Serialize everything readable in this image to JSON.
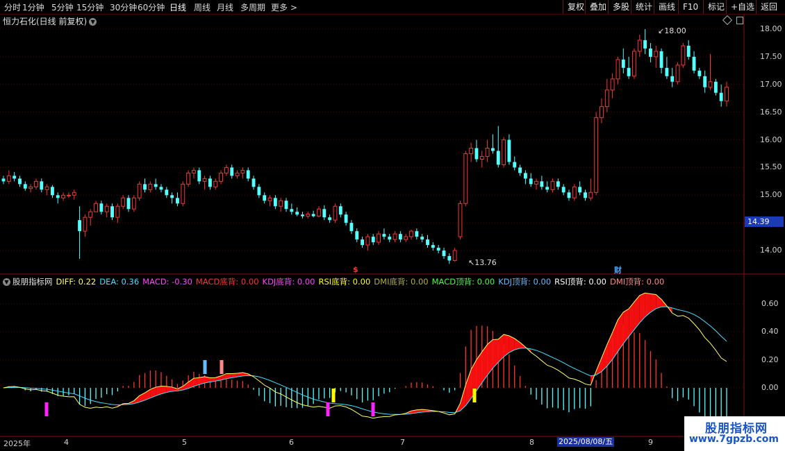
{
  "toolbar": {
    "left": [
      "分时",
      "1分钟",
      "5分钟",
      "15分钟",
      "30分钟",
      "60分钟",
      "日线",
      "周线",
      "月线",
      "多周期",
      "更多 >"
    ],
    "active": "日线",
    "right": [
      "复权",
      "叠加",
      "多股",
      "统计",
      "画线",
      "F10",
      "标记",
      "+自选",
      "返回"
    ]
  },
  "main_title": "恒力石化(日线 前复权)",
  "current_price": "14.39",
  "price_axis": [
    "18.00",
    "17.50",
    "17.00",
    "16.50",
    "16.00",
    "15.50",
    "15.00",
    "14.00"
  ],
  "annotations": {
    "high": "18.00",
    "low": "13.76",
    "marker_s": "$",
    "marker_cai": "财"
  },
  "indicator": {
    "name": "股朋指标网",
    "items": [
      {
        "label": "DIFF: 0.22",
        "color": "#ffff66"
      },
      {
        "label": "DEA: 0.36",
        "color": "#44e0ff"
      },
      {
        "label": "MACD: -0.30",
        "color": "#ff44ff"
      },
      {
        "label": "MACD底背: 0.00",
        "color": "#ff3333"
      },
      {
        "label": "KDJ底背: 0.00",
        "color": "#ff44ff"
      },
      {
        "label": "RSI底背: 0.00",
        "color": "#ffff00"
      },
      {
        "label": "DMI底背: 0.00",
        "color": "#b0b040"
      },
      {
        "label": "MACD顶背: 0.00",
        "color": "#44ff44"
      },
      {
        "label": "KDJ顶背: 0.00",
        "color": "#66bbff"
      },
      {
        "label": "RSI顶背: 0.00",
        "color": "#ffffff"
      },
      {
        "label": "DMI顶背: 0.00",
        "color": "#ff8888"
      }
    ],
    "axis": [
      "0.60",
      "0.40",
      "0.20",
      "0.00"
    ]
  },
  "time_axis": [
    "2025年",
    "4",
    "5",
    "6",
    "7",
    "8",
    "9"
  ],
  "selected_date": "2025/08/08/五",
  "watermark": {
    "title": "股朋指标网",
    "url": "www.7gpzb.com"
  },
  "colors": {
    "up": "#ff3333",
    "down": "#54ffff",
    "grid": "#5a0000"
  },
  "chart_data": {
    "type": "candlestick",
    "title": "恒力石化(日线 前复权)",
    "ylim": [
      13.6,
      18.15
    ],
    "candles": [
      [
        15.3,
        15.35,
        15.2,
        15.25
      ],
      [
        15.25,
        15.45,
        15.2,
        15.35
      ],
      [
        15.35,
        15.42,
        15.25,
        15.3
      ],
      [
        15.3,
        15.35,
        15.15,
        15.2
      ],
      [
        15.2,
        15.25,
        15.08,
        15.12
      ],
      [
        15.12,
        15.2,
        15.05,
        15.15
      ],
      [
        15.15,
        15.3,
        15.1,
        15.25
      ],
      [
        15.25,
        15.3,
        15.05,
        15.1
      ],
      [
        15.1,
        15.2,
        15.0,
        15.15
      ],
      [
        15.15,
        15.18,
        14.95,
        15.0
      ],
      [
        15.0,
        15.05,
        14.85,
        14.95
      ],
      [
        14.95,
        15.05,
        14.9,
        15.0
      ],
      [
        15.0,
        15.05,
        14.95,
        15.0
      ],
      [
        15.0,
        15.1,
        14.92,
        15.05
      ],
      [
        14.55,
        14.8,
        13.85,
        14.35
      ],
      [
        14.35,
        14.65,
        14.25,
        14.6
      ],
      [
        14.6,
        14.75,
        14.45,
        14.7
      ],
      [
        14.7,
        14.9,
        14.7,
        14.85
      ],
      [
        14.85,
        14.9,
        14.65,
        14.7
      ],
      [
        14.7,
        14.85,
        14.6,
        14.8
      ],
      [
        14.8,
        14.85,
        14.55,
        14.6
      ],
      [
        14.6,
        14.85,
        14.5,
        14.8
      ],
      [
        14.8,
        15.0,
        14.75,
        14.95
      ],
      [
        14.95,
        15.0,
        14.7,
        14.75
      ],
      [
        14.75,
        15.0,
        14.7,
        14.95
      ],
      [
        14.95,
        15.25,
        14.9,
        15.2
      ],
      [
        15.2,
        15.3,
        15.05,
        15.1
      ],
      [
        15.1,
        15.25,
        15.05,
        15.2
      ],
      [
        15.2,
        15.3,
        15.1,
        15.15
      ],
      [
        15.15,
        15.2,
        15.05,
        15.1
      ],
      [
        15.1,
        15.15,
        14.95,
        15.0
      ],
      [
        15.0,
        15.05,
        14.85,
        14.95
      ],
      [
        14.95,
        15.05,
        14.8,
        14.85
      ],
      [
        14.85,
        15.25,
        14.8,
        15.2
      ],
      [
        15.2,
        15.45,
        15.15,
        15.4
      ],
      [
        15.4,
        15.5,
        15.3,
        15.45
      ],
      [
        15.45,
        15.5,
        15.2,
        15.25
      ],
      [
        15.25,
        15.35,
        15.1,
        15.3
      ],
      [
        15.3,
        15.35,
        15.1,
        15.15
      ],
      [
        15.15,
        15.3,
        15.1,
        15.25
      ],
      [
        15.25,
        15.45,
        15.2,
        15.4
      ],
      [
        15.4,
        15.55,
        15.35,
        15.5
      ],
      [
        15.5,
        15.55,
        15.3,
        15.35
      ],
      [
        15.35,
        15.45,
        15.3,
        15.4
      ],
      [
        15.4,
        15.5,
        15.3,
        15.45
      ],
      [
        15.45,
        15.5,
        15.25,
        15.3
      ],
      [
        15.3,
        15.35,
        15.1,
        15.15
      ],
      [
        15.15,
        15.2,
        14.95,
        15.0
      ],
      [
        15.0,
        15.05,
        14.85,
        14.9
      ],
      [
        14.9,
        15.0,
        14.8,
        14.95
      ],
      [
        14.95,
        15.0,
        14.75,
        14.8
      ],
      [
        14.8,
        14.95,
        14.7,
        14.9
      ],
      [
        14.9,
        14.95,
        14.7,
        14.75
      ],
      [
        14.75,
        14.85,
        14.65,
        14.7
      ],
      [
        14.7,
        14.78,
        14.62,
        14.65
      ],
      [
        14.65,
        14.7,
        14.58,
        14.62
      ],
      [
        14.62,
        14.7,
        14.58,
        14.66
      ],
      [
        14.66,
        14.72,
        14.6,
        14.62
      ],
      [
        14.62,
        14.8,
        14.6,
        14.75
      ],
      [
        14.75,
        14.82,
        14.55,
        14.6
      ],
      [
        14.6,
        14.65,
        14.5,
        14.55
      ],
      [
        14.55,
        14.85,
        14.5,
        14.8
      ],
      [
        14.8,
        14.85,
        14.6,
        14.65
      ],
      [
        14.65,
        14.7,
        14.45,
        14.5
      ],
      [
        14.5,
        14.55,
        14.3,
        14.35
      ],
      [
        14.35,
        14.4,
        14.15,
        14.2
      ],
      [
        14.2,
        14.25,
        14.05,
        14.1
      ],
      [
        14.1,
        14.3,
        14.0,
        14.25
      ],
      [
        14.25,
        14.3,
        14.1,
        14.15
      ],
      [
        14.15,
        14.35,
        14.1,
        14.3
      ],
      [
        14.3,
        14.4,
        14.2,
        14.25
      ],
      [
        14.25,
        14.3,
        14.15,
        14.2
      ],
      [
        14.2,
        14.35,
        14.15,
        14.3
      ],
      [
        14.3,
        14.35,
        14.15,
        14.2
      ],
      [
        14.2,
        14.3,
        14.15,
        14.25
      ],
      [
        14.25,
        14.38,
        14.2,
        14.35
      ],
      [
        14.35,
        14.4,
        14.2,
        14.25
      ],
      [
        14.25,
        14.3,
        14.15,
        14.2
      ],
      [
        14.2,
        14.28,
        14.05,
        14.1
      ],
      [
        14.1,
        14.15,
        14.0,
        14.05
      ],
      [
        14.05,
        14.1,
        13.95,
        14.0
      ],
      [
        14.0,
        14.05,
        13.85,
        13.9
      ],
      [
        13.9,
        13.95,
        13.76,
        13.82
      ],
      [
        13.82,
        14.05,
        13.8,
        14.0
      ],
      [
        14.25,
        14.9,
        14.2,
        14.85
      ],
      [
        14.85,
        15.8,
        14.8,
        15.75
      ],
      [
        15.75,
        15.95,
        15.6,
        15.85
      ],
      [
        15.85,
        16.0,
        15.6,
        15.65
      ],
      [
        15.65,
        15.8,
        15.5,
        15.7
      ],
      [
        15.7,
        16.0,
        15.6,
        15.85
      ],
      [
        15.85,
        16.1,
        15.75,
        15.8
      ],
      [
        15.8,
        16.25,
        15.5,
        15.55
      ],
      [
        15.55,
        16.05,
        15.5,
        16.0
      ],
      [
        16.0,
        16.1,
        15.55,
        15.6
      ],
      [
        15.6,
        15.7,
        15.45,
        15.5
      ],
      [
        15.5,
        15.55,
        15.35,
        15.4
      ],
      [
        15.4,
        15.45,
        15.2,
        15.3
      ],
      [
        15.3,
        15.4,
        15.15,
        15.2
      ],
      [
        15.2,
        15.3,
        15.1,
        15.25
      ],
      [
        15.25,
        15.35,
        15.1,
        15.15
      ],
      [
        15.15,
        15.25,
        15.05,
        15.1
      ],
      [
        15.1,
        15.3,
        15.05,
        15.25
      ],
      [
        15.25,
        15.3,
        15.1,
        15.15
      ],
      [
        15.15,
        15.2,
        15.0,
        15.05
      ],
      [
        15.05,
        15.1,
        14.9,
        14.95
      ],
      [
        14.95,
        15.2,
        14.9,
        15.15
      ],
      [
        15.15,
        15.25,
        15.0,
        15.05
      ],
      [
        15.05,
        15.1,
        14.9,
        14.95
      ],
      [
        14.95,
        15.3,
        14.9,
        15.05
      ],
      [
        15.05,
        16.5,
        15.0,
        16.4
      ],
      [
        16.4,
        16.75,
        16.3,
        16.6
      ],
      [
        16.6,
        17.1,
        16.5,
        16.9
      ],
      [
        16.9,
        17.2,
        16.75,
        17.1
      ],
      [
        17.1,
        17.5,
        17.0,
        17.45
      ],
      [
        17.45,
        17.65,
        17.2,
        17.3
      ],
      [
        17.3,
        17.5,
        17.1,
        17.15
      ],
      [
        17.15,
        17.65,
        17.1,
        17.6
      ],
      [
        17.6,
        17.9,
        17.5,
        17.8
      ],
      [
        17.8,
        18.0,
        17.55,
        17.65
      ],
      [
        17.65,
        17.75,
        17.4,
        17.5
      ],
      [
        17.5,
        17.7,
        17.3,
        17.6
      ],
      [
        17.6,
        17.65,
        17.2,
        17.3
      ],
      [
        17.3,
        17.5,
        17.1,
        17.15
      ],
      [
        17.15,
        17.3,
        16.95,
        17.05
      ],
      [
        17.05,
        17.4,
        17.0,
        17.35
      ],
      [
        17.35,
        17.75,
        17.3,
        17.7
      ],
      [
        17.7,
        17.8,
        17.45,
        17.5
      ],
      [
        17.5,
        17.6,
        17.2,
        17.25
      ],
      [
        17.25,
        17.3,
        17.1,
        17.15
      ],
      [
        17.15,
        17.25,
        16.85,
        16.95
      ],
      [
        16.95,
        17.55,
        16.9,
        17.05
      ],
      [
        17.05,
        17.1,
        16.8,
        16.85
      ],
      [
        16.85,
        17.0,
        16.6,
        16.7
      ],
      [
        16.7,
        17.05,
        16.6,
        16.95
      ]
    ]
  }
}
